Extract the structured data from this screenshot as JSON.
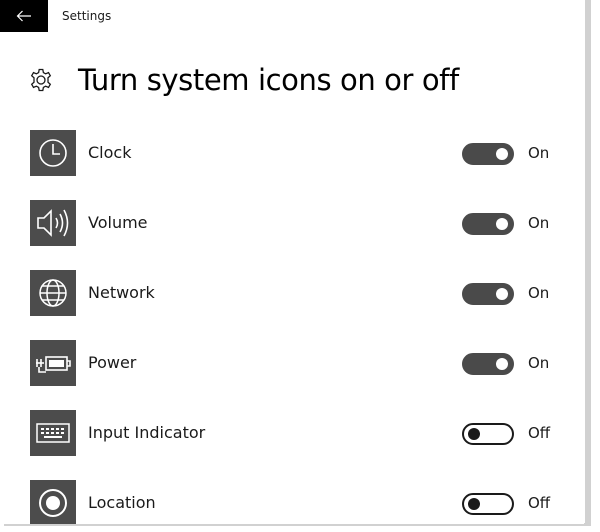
{
  "window": {
    "title": "Settings",
    "back_icon": "back-arrow-icon"
  },
  "page": {
    "title": "Turn system icons on or off",
    "icon": "gear-icon"
  },
  "settings": [
    {
      "label": "Clock",
      "icon": "clock-icon",
      "state": "On",
      "on": true
    },
    {
      "label": "Volume",
      "icon": "volume-icon",
      "state": "On",
      "on": true
    },
    {
      "label": "Network",
      "icon": "network-icon",
      "state": "On",
      "on": true
    },
    {
      "label": "Power",
      "icon": "power-icon",
      "state": "On",
      "on": true
    },
    {
      "label": "Input Indicator",
      "icon": "keyboard-icon",
      "state": "Off",
      "on": false
    },
    {
      "label": "Location",
      "icon": "location-icon",
      "state": "Off",
      "on": false
    }
  ],
  "colors": {
    "tile_background": "#4c4c4c",
    "toggle_on": "#4a4a4a",
    "titlebar_back_button": "#000000"
  }
}
